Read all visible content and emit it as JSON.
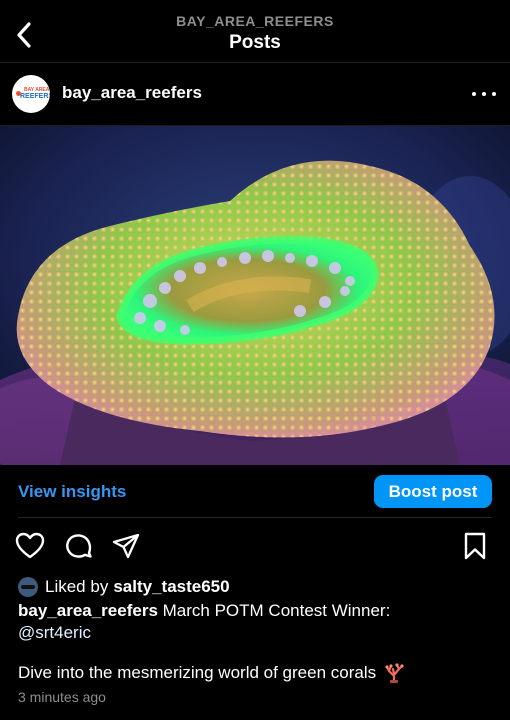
{
  "header": {
    "username": "BAY_AREA_REEFERS",
    "title": "Posts",
    "back_icon": "chevron-left-icon"
  },
  "post": {
    "author": "bay_area_reefers",
    "avatar_text_top": "BAY AREA",
    "avatar_text_bottom": "REEFERS",
    "more_icon": "more-horizontal-icon",
    "image": {
      "subject": "green acan coral",
      "colors": {
        "background": "#1a2b5a",
        "coral_green": "#6bd63a",
        "mouth_glow": "#2df57a",
        "polyps": "#c9c4e8",
        "rim_pink": "#e98aa6"
      }
    }
  },
  "insights": {
    "view_label": "View insights",
    "boost_label": "Boost post",
    "accent_color": "#0095f6"
  },
  "actions": {
    "like_icon": "heart-icon",
    "comment_icon": "comment-icon",
    "share_icon": "send-icon",
    "save_icon": "bookmark-icon"
  },
  "likes": {
    "prefix": "Liked by",
    "user": "salty_taste650"
  },
  "caption": {
    "author": "bay_area_reefers",
    "text": "March POTM Contest Winner:",
    "mention": "@srt4eric",
    "description": "Dive into the mesmerizing world of green corals",
    "emoji_icon": "coral-emoji-icon"
  },
  "timestamp": "3 minutes ago"
}
